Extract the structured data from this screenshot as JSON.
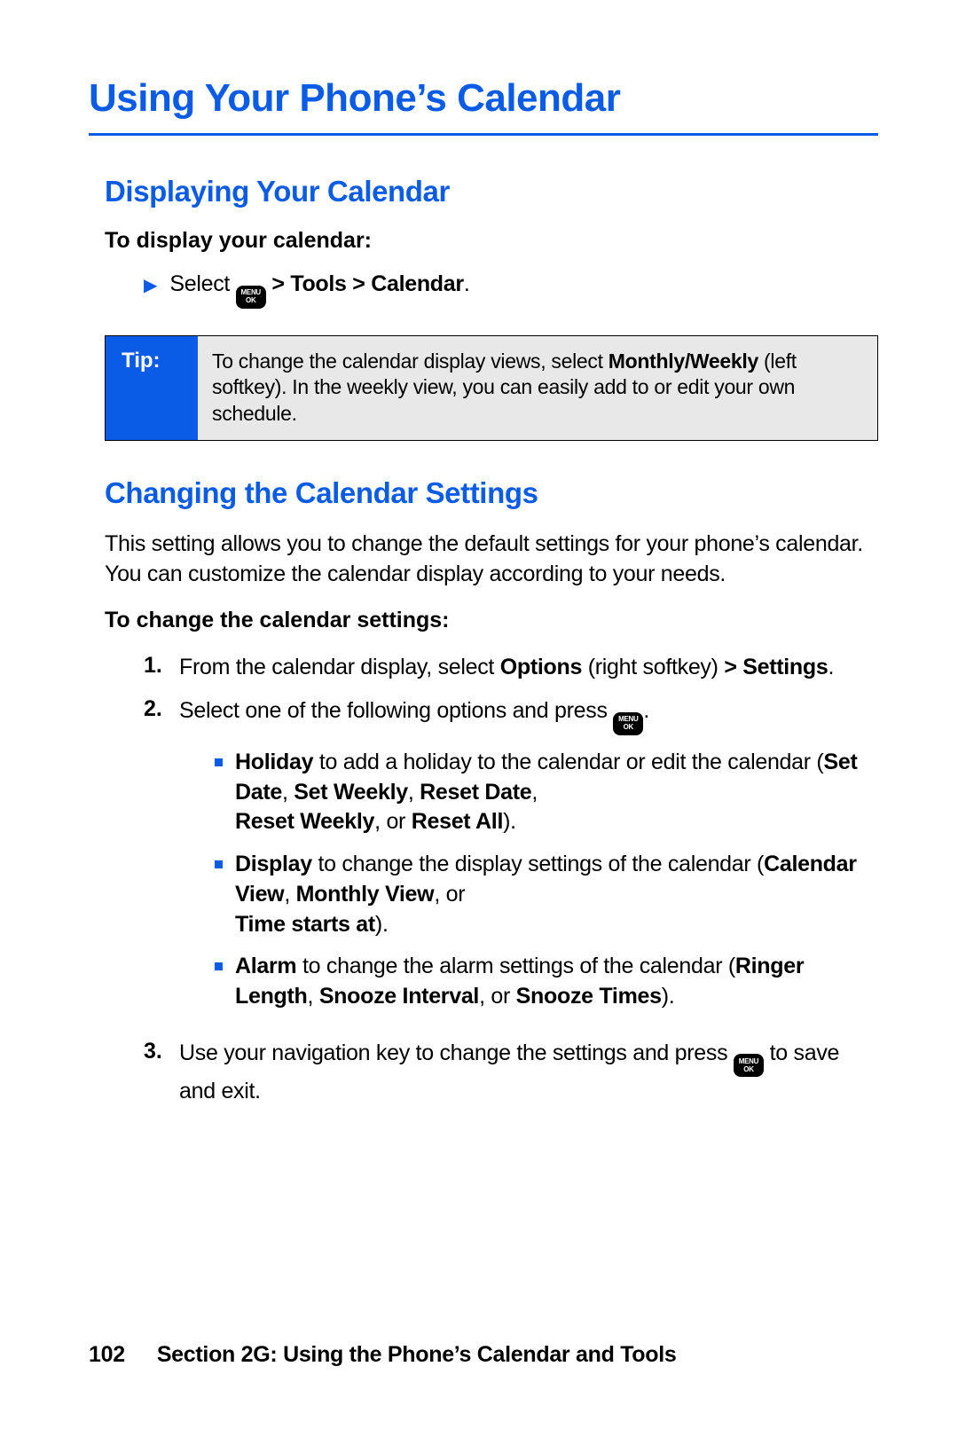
{
  "title": "Using Your Phone’s Calendar",
  "s1": {
    "heading": "Displaying Your Calendar",
    "lead": "To display your calendar:",
    "step_select": "Select ",
    "step_gt": " > ",
    "step_tools_calendar": "Tools > Calendar",
    "step_period": "."
  },
  "menuok": {
    "menu": "MENU",
    "ok": "OK"
  },
  "tip": {
    "label": "Tip:",
    "before": "To change the calendar display views, select ",
    "bold": "Monthly/Weekly",
    "after": " (left softkey). In the weekly view, you can easily add to or edit your own schedule."
  },
  "s2": {
    "heading": "Changing the Calendar Settings",
    "para": "This setting allows you to change the default settings for your phone’s calendar. You can customize the calendar display according to your needs.",
    "lead": "To change the calendar settings:"
  },
  "step1": {
    "num": "1.",
    "a": "From the calendar display, select ",
    "b": "Options",
    "c": " (right softkey) ",
    "d": "> Settings",
    "e": "."
  },
  "step2": {
    "num": "2.",
    "a": "Select one of the following options and press ",
    "c": "."
  },
  "opt_holiday": {
    "a": "Holiday",
    "b": " to add a holiday to the calendar or edit the calendar (",
    "c": "Set Date",
    "d": ", ",
    "e": "Set Weekly",
    "f": ", ",
    "g": "Reset Date",
    "h": ", ",
    "i": "Reset Weekly",
    "j": ", or ",
    "k": "Reset All",
    "l": ")."
  },
  "opt_display": {
    "a": "Display",
    "b": " to change the display settings of the calendar (",
    "c": "Calendar View",
    "d": ", ",
    "e": "Monthly View",
    "f": ", or ",
    "g": "Time starts at",
    "h": ")."
  },
  "opt_alarm": {
    "a": "Alarm",
    "b": " to change the alarm settings of the calendar (",
    "c": "Ringer Length",
    "d": ", ",
    "e": "Snooze Interval",
    "f": ", or ",
    "g": "Snooze Times",
    "h": ")."
  },
  "step3": {
    "num": "3.",
    "a": "Use your navigation key to change the settings and press ",
    "c": " to save and exit."
  },
  "footer": {
    "page": "102",
    "section": "Section 2G: Using the Phone’s Calendar and Tools"
  }
}
